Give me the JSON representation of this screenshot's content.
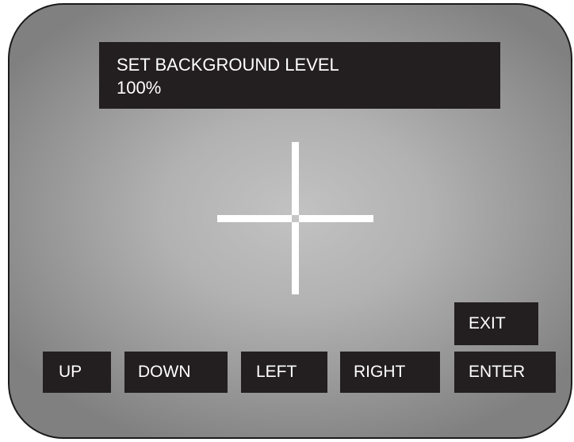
{
  "display": {
    "title": "SET BACKGROUND LEVEL",
    "level": "100%"
  },
  "buttons": {
    "exit": "EXIT",
    "up": "UP",
    "down": "DOWN",
    "left": "LEFT",
    "right": "RIGHT",
    "enter": "ENTER"
  },
  "colors": {
    "panel": "#231f20",
    "text": "#ffffff",
    "crosshair": "#ffffff"
  }
}
